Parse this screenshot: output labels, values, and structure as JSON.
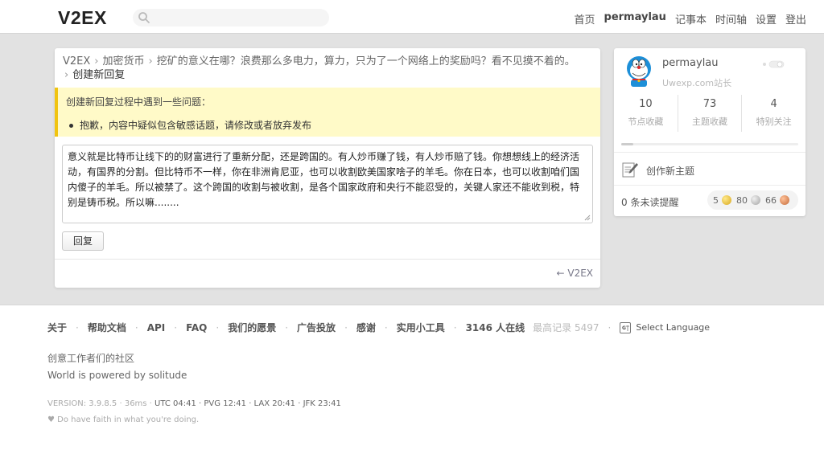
{
  "header": {
    "logo": "V2EX",
    "search_placeholder": "",
    "nav": [
      "首页",
      "permaylau",
      "记事本",
      "时间轴",
      "设置",
      "登出"
    ]
  },
  "breadcrumb": {
    "root": "V2EX",
    "node": "加密货币",
    "topic": "挖矿的意义在哪？浪费那么多电力，算力，只为了一个网络上的奖励吗？看不见摸不着的。",
    "current": "创建新回复",
    "separator": "›"
  },
  "warning": {
    "title": "创建新回复过程中遇到一些问题：",
    "items": [
      "抱歉，内容中疑似包含敏感话题，请修改或者放弃发布"
    ]
  },
  "reply": {
    "content": "意义就是比特币让线下的的财富进行了重新分配，还是跨国的。有人炒币赚了钱，有人炒币赔了钱。你想想线上的经济活动，有国界的分割。但比特币不一样，你在非洲肯尼亚，也可以收割欧美国家啥子的羊毛。你在日本，也可以收割咱们国内傻子的羊毛。所以被禁了。这个跨国的收割与被收割，是各个国家政府和央行不能忍受的，关键人家还不能收到税，特别是铸币税。所以嘛........",
    "button": "回复",
    "back_link": "← V2EX"
  },
  "sidebar": {
    "username": "permaylau",
    "tagline": "Uwexp.com站长",
    "stats": [
      {
        "value": "10",
        "label": "节点收藏"
      },
      {
        "value": "73",
        "label": "主题收藏"
      },
      {
        "value": "4",
        "label": "特别关注"
      }
    ],
    "progress": 0.07,
    "new_topic": "创作新主题",
    "unread": "0 条未读提醒",
    "balance": {
      "gold": "5",
      "silver": "80",
      "bronze": "66"
    }
  },
  "footer": {
    "links": [
      "关于",
      "帮助文档",
      "API",
      "FAQ",
      "我们的愿景",
      "广告投放",
      "感谢",
      "实用小工具"
    ],
    "online": "3146 人在线",
    "max_record": "最高记录 5497",
    "language": "Select Language",
    "slogan": "创意工作者们的社区",
    "powered": "World is powered by solitude",
    "version": "VERSION: 3.9.8.5 · 36ms · ",
    "timezones": "UTC 04:41 · PVG 12:41 · LAX 20:41 · JFK 23:41",
    "faith": "♥ Do have faith in what you're doing."
  },
  "colors": {
    "warning_bg": "#fffac8",
    "warning_border": "#f1c40f",
    "page_bg": "#e2e2e2"
  }
}
